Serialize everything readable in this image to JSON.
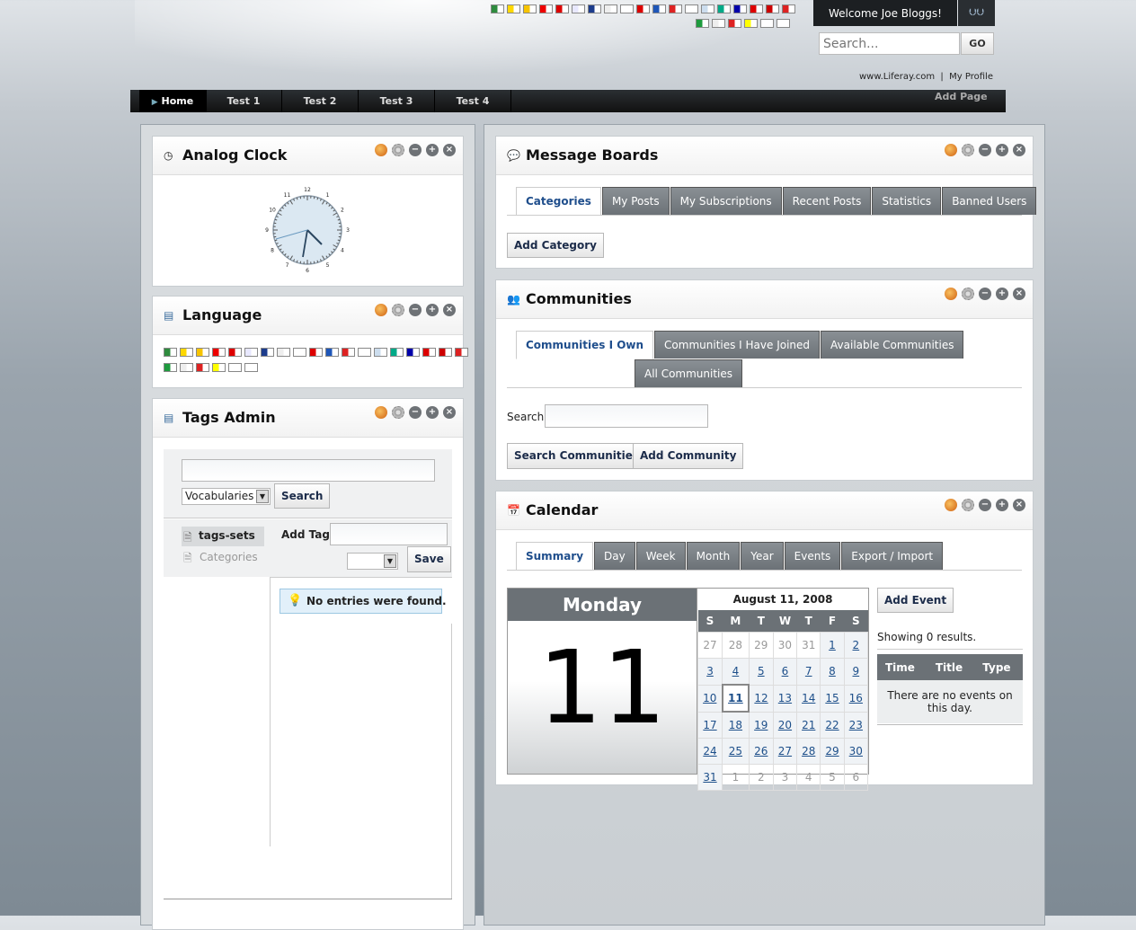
{
  "header": {
    "welcome": "Welcome Joe Bloggs!",
    "search_placeholder": "Search...",
    "go_label": "GO",
    "link_liferay": "www.Liferay.com",
    "link_profile": "My Profile",
    "add_page": "Add Page"
  },
  "flags_top": [
    "#2e8b3e",
    "#ffd800",
    "#f7c400",
    "#e00",
    "#d00",
    "#e8e8ff",
    "#1c3c8c",
    "#eee",
    "#fff",
    "#d00",
    "#1e56b8",
    "#d22",
    "#fff",
    "#cde",
    "#0a8",
    "#00a",
    "#d00",
    "#c00",
    "#d22"
  ],
  "flags_top2": [
    "#1e9b3e",
    "#eee",
    "#d22",
    "#ff0",
    "#fff",
    "#fff"
  ],
  "nav": {
    "tabs": [
      "Home",
      "Test 1",
      "Test 2",
      "Test 3",
      "Test 4"
    ]
  },
  "clock": {
    "title": "Analog Clock",
    "hours": [
      "12",
      "1",
      "2",
      "3",
      "4",
      "5",
      "6",
      "7",
      "8",
      "9",
      "10",
      "11"
    ]
  },
  "language": {
    "title": "Language"
  },
  "tags": {
    "title": "Tags Admin",
    "vocab_select": "Vocabularies",
    "search_btn": "Search",
    "tags_sets": "tags-sets",
    "categories": "Categories",
    "add_tag": "Add Tag",
    "save": "Save",
    "empty": "No entries were found."
  },
  "mb": {
    "title": "Message Boards",
    "tabs": [
      "Categories",
      "My Posts",
      "My Subscriptions",
      "Recent Posts",
      "Statistics",
      "Banned Users"
    ],
    "add_category": "Add Category"
  },
  "comm": {
    "title": "Communities",
    "tabs": [
      "Communities I Own",
      "Communities I Have Joined",
      "Available Communities"
    ],
    "tab_all": "All Communities",
    "search_label": "Search",
    "search_btn": "Search Communities",
    "add_btn": "Add Community"
  },
  "cal": {
    "title": "Calendar",
    "tabs": [
      "Summary",
      "Day",
      "Week",
      "Month",
      "Year",
      "Events",
      "Export / Import"
    ],
    "day_name": "Monday",
    "day_num": "11",
    "month_header": "August 11, 2008",
    "weekdays": [
      "S",
      "M",
      "T",
      "W",
      "T",
      "F",
      "S"
    ],
    "weeks": [
      [
        "27",
        "28",
        "29",
        "30",
        "31",
        "1",
        "2"
      ],
      [
        "3",
        "4",
        "5",
        "6",
        "7",
        "8",
        "9"
      ],
      [
        "10",
        "11",
        "12",
        "13",
        "14",
        "15",
        "16"
      ],
      [
        "17",
        "18",
        "19",
        "20",
        "21",
        "22",
        "23"
      ],
      [
        "24",
        "25",
        "26",
        "27",
        "28",
        "29",
        "30"
      ],
      [
        "31",
        "1",
        "2",
        "3",
        "4",
        "5",
        "6"
      ]
    ],
    "add_event": "Add Event",
    "showing": "Showing 0 results.",
    "cols": [
      "Time",
      "Title",
      "Type"
    ],
    "no_events": "There are no events on this day."
  }
}
